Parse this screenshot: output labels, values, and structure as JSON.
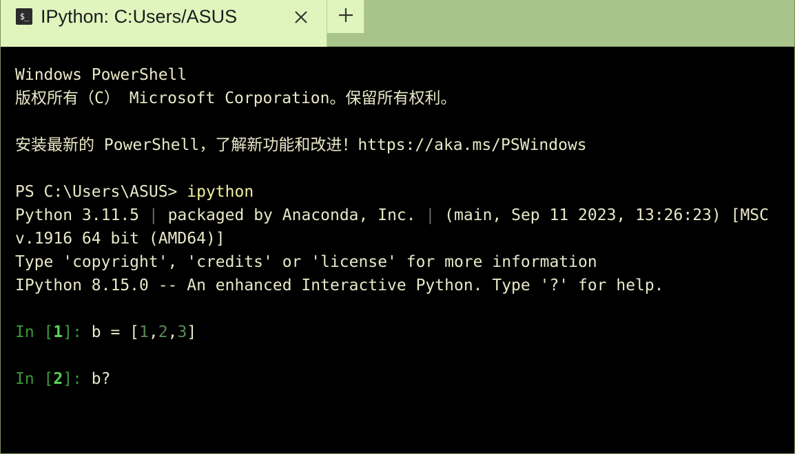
{
  "tab": {
    "icon_glyph": "$_",
    "title": "IPython: C:Users/ASUS",
    "close_icon": "close-icon",
    "new_tab_icon": "plus-icon"
  },
  "console": {
    "line1": "Windows PowerShell",
    "line2": "版权所有（C） Microsoft Corporation。保留所有权利。",
    "line3": "",
    "line4": "安装最新的 PowerShell，了解新功能和改进！https://aka.ms/PSWindows",
    "line5": "",
    "prompt_ps": "PS C:\\Users\\ASUS> ",
    "command": "ipython",
    "python_a": "Python 3.11.5 ",
    "sep1": "|",
    "python_b": " packaged by Anaconda, Inc. ",
    "sep2": "|",
    "python_c": " (main, Sep 11 2023, 13:26:23) [MSC",
    "line7": "v.1916 64 bit (AMD64)]",
    "line8": "Type 'copyright', 'credits' or 'license' for more information",
    "line9": "IPython 8.15.0 -- An enhanced Interactive Python. Type '?' for help.",
    "in1_prefix": "In [",
    "in1_num": "1",
    "in1_suffix": "]: ",
    "in1_code_a": "b = [",
    "in1_v1": "1",
    "in1_c1": ",",
    "in1_v2": "2",
    "in1_c2": ",",
    "in1_v3": "3",
    "in1_code_b": "]",
    "in2_prefix": "In [",
    "in2_num": "2",
    "in2_suffix": "]: ",
    "in2_code": "b?"
  },
  "colors": {
    "tab_bg": "#dff5bd",
    "tabbar_bg": "#a8c48a",
    "console_bg": "#000000",
    "prompt_green": "#3a9a3a"
  }
}
